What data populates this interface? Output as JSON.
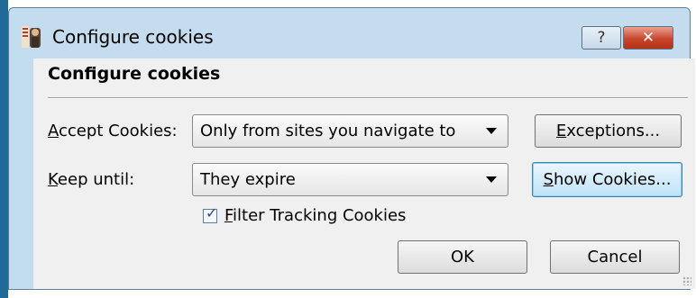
{
  "window": {
    "title": "Configure cookies",
    "help_label": "?",
    "close_label": "✕"
  },
  "section_title": "Configure cookies",
  "accept": {
    "label_underlined": "A",
    "label_rest": "ccept Cookies:",
    "selected": "Only from sites you navigate to"
  },
  "exceptions_button": {
    "underlined": "E",
    "rest": "xceptions..."
  },
  "keep": {
    "label_underlined": "K",
    "label_rest": "eep until:",
    "selected": "They expire"
  },
  "show_cookies_button": {
    "underlined": "S",
    "rest": "how Cookies..."
  },
  "filter_checkbox": {
    "checked": true,
    "label_underlined": "F",
    "label_rest": "ilter Tracking Cookies"
  },
  "ok_label": "OK",
  "cancel_label": "Cancel",
  "colors": {
    "title_frame": "#c3dcee",
    "close_button": "#c9462c",
    "focus_border": "#3c7fb1"
  }
}
